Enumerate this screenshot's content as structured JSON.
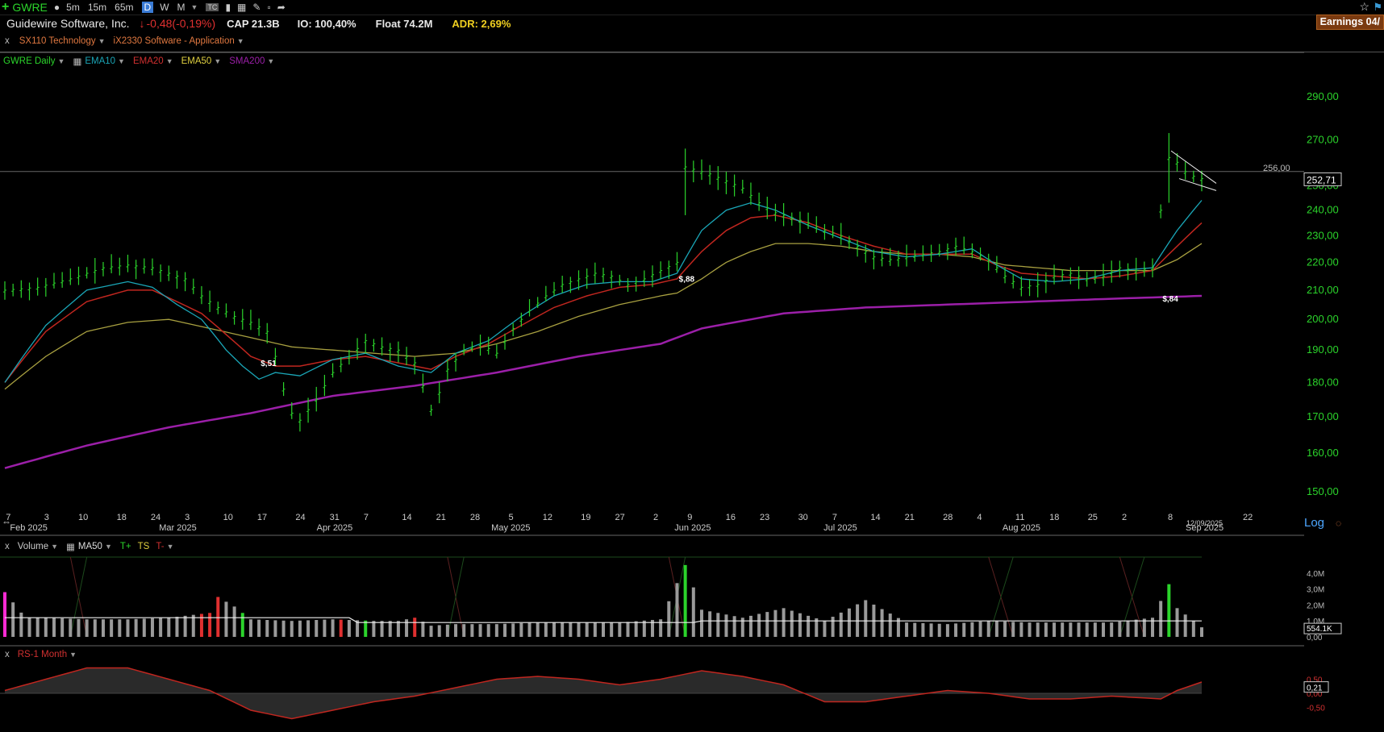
{
  "toolbar": {
    "symbol": "GWRE",
    "timeframes": [
      "5m",
      "15m",
      "65m",
      "D",
      "W",
      "M"
    ],
    "active_timeframe": "D"
  },
  "info": {
    "company": "Guidewire Software, Inc.",
    "change": "-0,48(-0,19%)",
    "cap": "CAP 21.3B",
    "io": "IO: 100,40%",
    "float": "Float 74.2M",
    "adr": "ADR: 2,69%",
    "earnings": "Earnings 04/"
  },
  "sector": {
    "close": "x",
    "sector": "SX110 Technology",
    "industry": "iX2330 Software - Application"
  },
  "price_legend": {
    "main": "GWRE Daily",
    "ema10": "EMA10",
    "ema20": "EMA20",
    "ema50": "EMA50",
    "sma200": "SMA200"
  },
  "price_axis": {
    "labels": [
      "290,00",
      "270,00",
      "250,00",
      "240,00",
      "230,00",
      "220,00",
      "210,00",
      "200,00",
      "190,00",
      "180,00",
      "170,00",
      "160,00",
      "150,00"
    ],
    "current_price": "252,71",
    "alert_price": "256,00",
    "scale_button": "Log"
  },
  "dates": {
    "days": [
      "7",
      "3",
      "10",
      "18",
      "24",
      "3",
      "10",
      "17",
      "24",
      "31",
      "7",
      "14",
      "21",
      "28",
      "5",
      "12",
      "19",
      "27",
      "2",
      "9",
      "16",
      "23",
      "30",
      "7",
      "14",
      "21",
      "28",
      "4",
      "11",
      "18",
      "25",
      "2",
      "8",
      "22"
    ],
    "months": [
      "Feb 2025",
      "Mar 2025",
      "Apr 2025",
      "May 2025",
      "Jun 2025",
      "Jul 2025",
      "Aug 2025",
      "Sep 2025"
    ],
    "cursor_date": "12/09/2025"
  },
  "earnings_markers": [
    "$,51",
    "$,88",
    "$,84"
  ],
  "volume_legend": {
    "close": "x",
    "label": "Volume",
    "ma": "MA50",
    "tplus": "T+",
    "ts": "TS",
    "tminus": "T-"
  },
  "volume_axis": {
    "labels": [
      "4,0M",
      "3,0M",
      "2,0M",
      "1,0M",
      "0,00"
    ],
    "current": "554.1K"
  },
  "rs_legend": {
    "close": "x",
    "label": "RS-1 Month"
  },
  "rs_axis": {
    "labels": [
      "0,50",
      "0,00",
      "-0,50"
    ],
    "current": "0,21"
  },
  "colors": {
    "up": "#2bd42b",
    "down": "#e03030",
    "ema10": "#1aa6b7",
    "ema20": "#c0261f",
    "ema50": "#a8a040",
    "sma200": "#9b1fa8",
    "volume": "#9a9a9a",
    "rs_line": "#c0261f"
  },
  "chart_data": {
    "type": "ohlc",
    "symbol": "GWRE",
    "interval": "Daily",
    "y_scale": "log",
    "ylim": [
      145,
      300
    ],
    "price_path": [
      [
        0,
        210
      ],
      [
        8,
        211
      ],
      [
        16,
        214
      ],
      [
        24,
        218
      ],
      [
        30,
        219
      ],
      [
        36,
        218
      ],
      [
        40,
        216
      ],
      [
        44,
        214
      ],
      [
        48,
        208
      ],
      [
        52,
        204
      ],
      [
        56,
        201
      ],
      [
        60,
        199
      ],
      [
        64,
        196
      ],
      [
        66,
        188
      ],
      [
        68,
        178
      ],
      [
        70,
        171
      ],
      [
        72,
        169
      ],
      [
        76,
        175
      ],
      [
        80,
        183
      ],
      [
        84,
        188
      ],
      [
        88,
        193
      ],
      [
        92,
        191
      ],
      [
        96,
        190
      ],
      [
        100,
        186
      ],
      [
        102,
        179
      ],
      [
        104,
        172
      ],
      [
        106,
        177
      ],
      [
        108,
        184
      ],
      [
        112,
        190
      ],
      [
        116,
        192
      ],
      [
        120,
        189
      ],
      [
        124,
        197
      ],
      [
        128,
        203
      ],
      [
        132,
        208
      ],
      [
        136,
        212
      ],
      [
        140,
        214
      ],
      [
        144,
        216
      ],
      [
        148,
        215
      ],
      [
        152,
        212
      ],
      [
        156,
        214
      ],
      [
        160,
        217
      ],
      [
        164,
        220
      ],
      [
        166,
        258
      ],
      [
        168,
        257
      ],
      [
        172,
        255
      ],
      [
        176,
        252
      ],
      [
        180,
        249
      ],
      [
        184,
        243
      ],
      [
        188,
        239
      ],
      [
        192,
        237
      ],
      [
        196,
        235
      ],
      [
        200,
        232
      ],
      [
        204,
        230
      ],
      [
        208,
        226
      ],
      [
        212,
        222
      ],
      [
        216,
        221
      ],
      [
        220,
        222
      ],
      [
        224,
        223
      ],
      [
        228,
        224
      ],
      [
        232,
        226
      ],
      [
        236,
        224
      ],
      [
        240,
        221
      ],
      [
        244,
        215
      ],
      [
        248,
        211
      ],
      [
        252,
        212
      ],
      [
        256,
        215
      ],
      [
        260,
        216
      ],
      [
        264,
        214
      ],
      [
        268,
        215
      ],
      [
        272,
        218
      ],
      [
        276,
        217
      ],
      [
        280,
        218
      ],
      [
        284,
        262
      ],
      [
        286,
        260
      ],
      [
        288,
        256
      ],
      [
        290,
        254
      ],
      [
        292,
        253
      ]
    ],
    "ema10_path": [
      [
        0,
        180
      ],
      [
        10,
        198
      ],
      [
        20,
        210
      ],
      [
        30,
        213
      ],
      [
        36,
        211
      ],
      [
        42,
        205
      ],
      [
        48,
        200
      ],
      [
        54,
        190
      ],
      [
        58,
        185
      ],
      [
        62,
        181
      ],
      [
        66,
        183
      ],
      [
        72,
        182
      ],
      [
        80,
        187
      ],
      [
        88,
        189
      ],
      [
        96,
        185
      ],
      [
        104,
        183
      ],
      [
        110,
        189
      ],
      [
        118,
        193
      ],
      [
        126,
        201
      ],
      [
        134,
        208
      ],
      [
        142,
        212
      ],
      [
        150,
        213
      ],
      [
        158,
        213
      ],
      [
        164,
        216
      ],
      [
        170,
        232
      ],
      [
        176,
        240
      ],
      [
        182,
        243
      ],
      [
        188,
        240
      ],
      [
        196,
        234
      ],
      [
        204,
        229
      ],
      [
        212,
        224
      ],
      [
        220,
        222
      ],
      [
        228,
        223
      ],
      [
        236,
        225
      ],
      [
        242,
        219
      ],
      [
        248,
        214
      ],
      [
        256,
        213
      ],
      [
        264,
        214
      ],
      [
        272,
        217
      ],
      [
        280,
        218
      ],
      [
        286,
        232
      ],
      [
        292,
        244
      ]
    ],
    "ema20_path": [
      [
        0,
        180
      ],
      [
        10,
        196
      ],
      [
        20,
        206
      ],
      [
        30,
        210
      ],
      [
        36,
        210
      ],
      [
        42,
        206
      ],
      [
        48,
        202
      ],
      [
        54,
        195
      ],
      [
        60,
        188
      ],
      [
        66,
        185
      ],
      [
        72,
        185
      ],
      [
        80,
        187
      ],
      [
        88,
        188
      ],
      [
        96,
        186
      ],
      [
        104,
        184
      ],
      [
        110,
        188
      ],
      [
        118,
        192
      ],
      [
        126,
        198
      ],
      [
        134,
        204
      ],
      [
        142,
        208
      ],
      [
        150,
        211
      ],
      [
        158,
        212
      ],
      [
        164,
        214
      ],
      [
        170,
        224
      ],
      [
        176,
        232
      ],
      [
        182,
        237
      ],
      [
        188,
        238
      ],
      [
        196,
        235
      ],
      [
        204,
        230
      ],
      [
        212,
        226
      ],
      [
        220,
        223
      ],
      [
        228,
        223
      ],
      [
        236,
        223
      ],
      [
        242,
        219
      ],
      [
        248,
        216
      ],
      [
        256,
        215
      ],
      [
        264,
        214
      ],
      [
        272,
        215
      ],
      [
        280,
        217
      ],
      [
        286,
        226
      ],
      [
        292,
        235
      ]
    ],
    "ema50_path": [
      [
        0,
        178
      ],
      [
        10,
        188
      ],
      [
        20,
        196
      ],
      [
        30,
        199
      ],
      [
        40,
        200
      ],
      [
        50,
        197
      ],
      [
        60,
        194
      ],
      [
        70,
        191
      ],
      [
        80,
        190
      ],
      [
        90,
        189
      ],
      [
        100,
        188
      ],
      [
        110,
        189
      ],
      [
        120,
        192
      ],
      [
        130,
        196
      ],
      [
        140,
        201
      ],
      [
        150,
        205
      ],
      [
        160,
        208
      ],
      [
        164,
        209
      ],
      [
        170,
        214
      ],
      [
        176,
        220
      ],
      [
        182,
        224
      ],
      [
        188,
        227
      ],
      [
        196,
        227
      ],
      [
        204,
        226
      ],
      [
        212,
        224
      ],
      [
        220,
        223
      ],
      [
        228,
        223
      ],
      [
        236,
        222
      ],
      [
        244,
        219
      ],
      [
        252,
        218
      ],
      [
        260,
        217
      ],
      [
        270,
        217
      ],
      [
        280,
        217
      ],
      [
        286,
        221
      ],
      [
        292,
        227
      ]
    ],
    "sma200_path": [
      [
        0,
        156
      ],
      [
        20,
        162
      ],
      [
        40,
        167
      ],
      [
        60,
        171
      ],
      [
        80,
        176
      ],
      [
        100,
        179
      ],
      [
        120,
        183
      ],
      [
        140,
        188
      ],
      [
        160,
        192
      ],
      [
        170,
        197
      ],
      [
        190,
        202
      ],
      [
        210,
        204
      ],
      [
        230,
        205
      ],
      [
        250,
        206
      ],
      [
        270,
        207
      ],
      [
        292,
        208
      ]
    ],
    "volume_path": [
      [
        0,
        2.8
      ],
      [
        5,
        1.2
      ],
      [
        10,
        1.2
      ],
      [
        20,
        1.1
      ],
      [
        30,
        1.1
      ],
      [
        40,
        1.2
      ],
      [
        50,
        1.5
      ],
      [
        52,
        2.5
      ],
      [
        56,
        1.9
      ],
      [
        60,
        1.1
      ],
      [
        70,
        1.0
      ],
      [
        80,
        1.1
      ],
      [
        90,
        1.0
      ],
      [
        96,
        1.0
      ],
      [
        100,
        1.2
      ],
      [
        104,
        0.7
      ],
      [
        110,
        0.8
      ],
      [
        120,
        0.8
      ],
      [
        130,
        0.9
      ],
      [
        140,
        0.9
      ],
      [
        150,
        0.9
      ],
      [
        160,
        1.1
      ],
      [
        166,
        4.5
      ],
      [
        170,
        1.7
      ],
      [
        180,
        1.2
      ],
      [
        190,
        1.8
      ],
      [
        200,
        1.0
      ],
      [
        210,
        2.3
      ],
      [
        220,
        0.9
      ],
      [
        230,
        0.8
      ],
      [
        240,
        1.0
      ],
      [
        250,
        0.9
      ],
      [
        260,
        0.9
      ],
      [
        270,
        0.9
      ],
      [
        280,
        1.2
      ],
      [
        284,
        3.3
      ],
      [
        286,
        1.8
      ],
      [
        290,
        1.0
      ],
      [
        292,
        0.6
      ]
    ],
    "rs_path": [
      [
        0,
        0.1
      ],
      [
        10,
        0.5
      ],
      [
        20,
        0.9
      ],
      [
        30,
        0.9
      ],
      [
        40,
        0.5
      ],
      [
        50,
        0.1
      ],
      [
        60,
        -0.6
      ],
      [
        70,
        -0.9
      ],
      [
        80,
        -0.6
      ],
      [
        90,
        -0.3
      ],
      [
        100,
        -0.1
      ],
      [
        110,
        0.2
      ],
      [
        120,
        0.5
      ],
      [
        130,
        0.6
      ],
      [
        140,
        0.5
      ],
      [
        150,
        0.3
      ],
      [
        160,
        0.5
      ],
      [
        170,
        0.8
      ],
      [
        180,
        0.6
      ],
      [
        190,
        0.3
      ],
      [
        200,
        -0.3
      ],
      [
        210,
        -0.3
      ],
      [
        220,
        -0.1
      ],
      [
        230,
        0.1
      ],
      [
        240,
        0.0
      ],
      [
        250,
        -0.2
      ],
      [
        260,
        -0.2
      ],
      [
        270,
        -0.1
      ],
      [
        282,
        -0.2
      ],
      [
        286,
        0.1
      ],
      [
        292,
        0.4
      ]
    ]
  }
}
